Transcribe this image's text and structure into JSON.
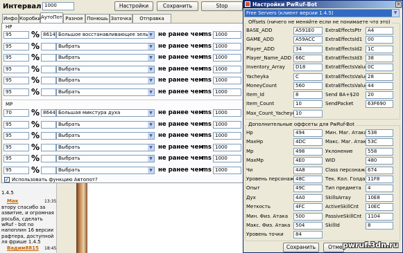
{
  "left": {
    "interval_label": "Интервал",
    "interval_value": "1000",
    "settings_button": "Настройки",
    "save_button": "Сохранить",
    "stop_button": "Stop",
    "tabs": [
      "Инфо",
      "Коробки",
      "АутоПот",
      "Разное",
      "Понюшь",
      "Заточка",
      "Отправка пакетов"
    ],
    "active_tab": "АутоПот",
    "hp_title": "HP",
    "mp_title": "MP",
    "hp_rows": [
      {
        "pct": "95",
        "id": "8614",
        "name": "Большое восстанавливающее зелье",
        "interval": "1000"
      },
      {
        "pct": "95",
        "id": "",
        "name": "Выбрать",
        "interval": "1000"
      },
      {
        "pct": "95",
        "id": "",
        "name": "Выбрать",
        "interval": "1000"
      },
      {
        "pct": "95",
        "id": "",
        "name": "Выбрать",
        "interval": "1000"
      },
      {
        "pct": "95",
        "id": "",
        "name": "Выбрать",
        "interval": "1000"
      },
      {
        "pct": "95",
        "id": "",
        "name": "Выбрать",
        "interval": "1000"
      }
    ],
    "mp_rows": [
      {
        "pct": "70",
        "id": "8644",
        "name": "Большая микстура духа",
        "interval": "1000"
      },
      {
        "pct": "95",
        "id": "",
        "name": "Выбрать",
        "interval": "1000"
      },
      {
        "pct": "95",
        "id": "",
        "name": "Выбрать",
        "interval": "1000"
      },
      {
        "pct": "95",
        "id": "",
        "name": "Выбрать",
        "interval": "1000"
      },
      {
        "pct": "95",
        "id": "",
        "name": "Выбрать",
        "interval": "1000"
      },
      {
        "pct": "95",
        "id": "",
        "name": "Выбрать",
        "interval": "1000"
      }
    ],
    "pct_symbol": "%",
    "not_earlier_label": "не ранее чем",
    "ms_label": "ms",
    "autopot_checkbox": "Использовать функцию Автопот?"
  },
  "chat": {
    "line0": "1.4.5",
    "user1": "Мак",
    "time1": "13:35",
    "msg1": [
      "втору спасибо за",
      "азвитие, и огромная",
      "росьба, сделать",
      "wRuf - bot no",
      "напоплин 16 версии",
      "рафтера, доступной",
      "ля фрише 1.4.5"
    ],
    "user2": "Вадим8815",
    "time2": "18:45"
  },
  "dialog": {
    "title": "Настройки PwRuf-Bot",
    "server_select": "Free Servers (клиент версии 1.4.5)",
    "offsets_title": "Offsets (ничего не меняйте если не понимаете что это)",
    "offsets": [
      {
        "l1": "BASE_ADD",
        "v1": "A591E0",
        "l2": "ExtraEffectsPtr",
        "v2": "A4"
      },
      {
        "l1": "GAME_ADD",
        "v1": "A59ACC",
        "l2": "ExtraEffectsId1",
        "v2": "00"
      },
      {
        "l1": "Player_ADD",
        "v1": "34",
        "l2": "ExtraEffectsId2",
        "v2": "1C"
      },
      {
        "l1": "Player_Name_ADD",
        "v1": "66C",
        "l2": "ExtraEffectsId3",
        "v2": "38"
      },
      {
        "l1": "Inventory_Array",
        "v1": "D18",
        "l2": "ExtraEffectsValue1",
        "v2": "0C"
      },
      {
        "l1": "Yacheyka",
        "v1": "C",
        "l2": "ExtraEffectsValue2",
        "v2": "28"
      },
      {
        "l1": "MoneyCount",
        "v1": "560",
        "l2": "ExtraEffectsValue3",
        "v2": "44"
      },
      {
        "l1": "Item_Id",
        "v1": "8",
        "l2": "Send BA+$20",
        "v2": "20"
      },
      {
        "l1": "Item_Count",
        "v1": "10",
        "l2": "SendPacket",
        "v2": "63F690"
      },
      {
        "l1": "Max_Count_Yacheyek",
        "v1": "10",
        "l2": "",
        "v2": ""
      }
    ],
    "extra_title": "Дополнительные оффсеты для PwRuf-Bot",
    "extra": [
      {
        "l1": "Hp",
        "v1": "494",
        "l2": "Мин. Маг. Атака",
        "v2": "538"
      },
      {
        "l1": "MaxHp",
        "v1": "4DC",
        "l2": "Макс. Маг. Атака",
        "v2": "53C"
      },
      {
        "l1": "Mp",
        "v1": "498",
        "l2": "Уклонение",
        "v2": "558"
      },
      {
        "l1": "MaxMp",
        "v1": "4E0",
        "l2": "WID",
        "v2": "480"
      },
      {
        "l1": "Чи",
        "v1": "4A8",
        "l2": "Class персонажа",
        "v2": "674"
      },
      {
        "l1": "Уровень персонажа",
        "v1": "48C",
        "l2": "Тек. Кол. Голда",
        "v2": "11F8"
      },
      {
        "l1": "Опыт",
        "v1": "49C",
        "l2": "Тип предмета",
        "v2": "4"
      },
      {
        "l1": "Дух",
        "v1": "4A0",
        "l2": "SkillsArray",
        "v2": "10E8"
      },
      {
        "l1": "Меткость",
        "v1": "4FC",
        "l2": "ActiveSkillCnt",
        "v2": "10EC"
      },
      {
        "l1": "Мин. Физ. Атака",
        "v1": "500",
        "l2": "PassiveSkillCnt",
        "v2": "1104"
      },
      {
        "l1": "Макс. Физ. Атака",
        "v1": "504",
        "l2": "SkillId",
        "v2": "8"
      },
      {
        "l1": "Уровень точки",
        "v1": "84",
        "l2": "",
        "v2": ""
      }
    ],
    "save_button": "Сохранить",
    "cancel_button": "Отме"
  },
  "watermark": "pwruf.3dn.ru",
  "colors": {
    "titlebar": "#0a246a",
    "select_bg": "#316ac5"
  }
}
